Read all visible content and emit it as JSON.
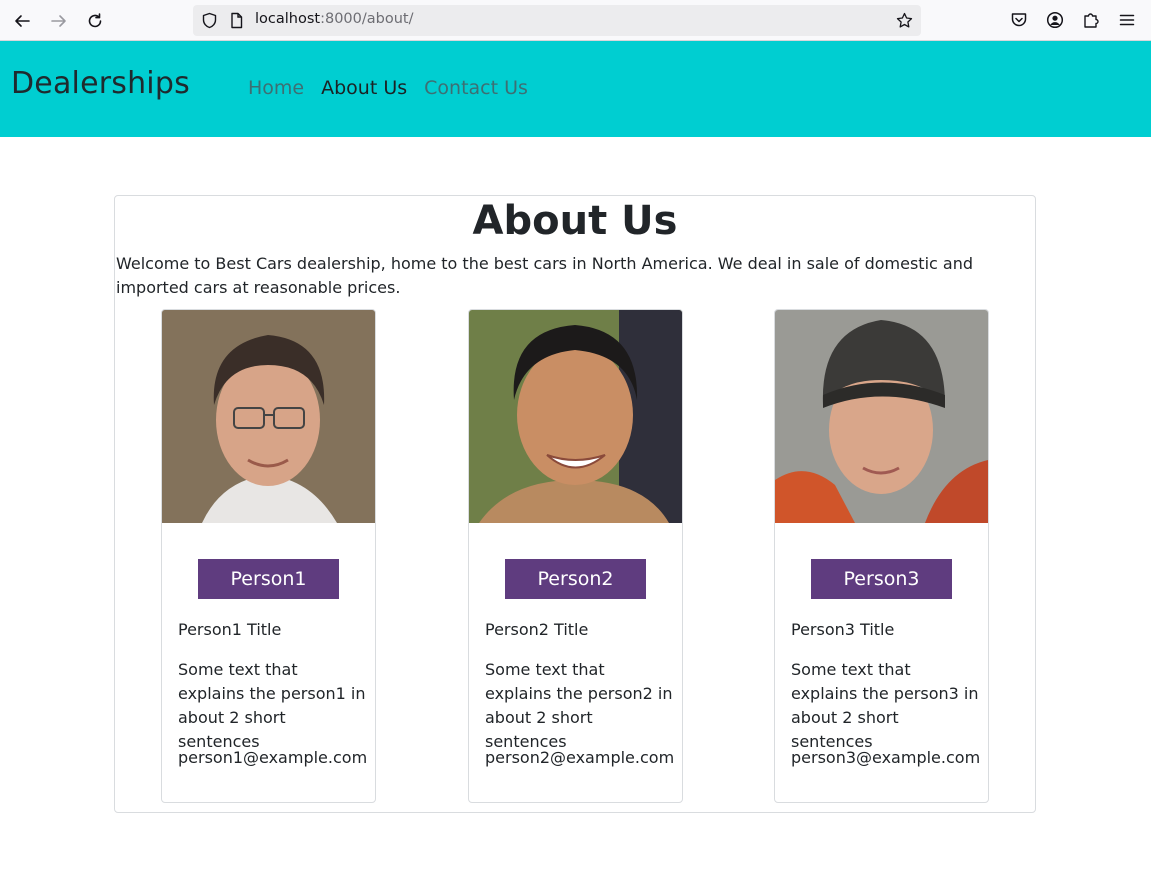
{
  "browser": {
    "url_host": "localhost",
    "url_path": ":8000/about/"
  },
  "header": {
    "brand": "Dealerships",
    "bg_color": "#00ced1",
    "nav": [
      {
        "label": "Home"
      },
      {
        "label": "About Us"
      },
      {
        "label": "Contact Us"
      }
    ]
  },
  "main": {
    "title": "About Us",
    "intro": "Welcome to Best Cars dealership, home to the best cars in North America. We deal in sale of domestic and imported cars at reasonable prices.",
    "accent_color": "#5f3c7f",
    "people": [
      {
        "name": "Person1",
        "title": "Person1 Title",
        "description": "Some text that explains the person1 in about 2 short sentences",
        "email": "person1@example.com"
      },
      {
        "name": "Person2",
        "title": "Person2 Title",
        "description": "Some text that explains the person2 in about 2 short sentences",
        "email": "person2@example.com"
      },
      {
        "name": "Person3",
        "title": "Person3 Title",
        "description": "Some text that explains the person3 in about 2 short sentences",
        "email": "person3@example.com"
      }
    ]
  }
}
